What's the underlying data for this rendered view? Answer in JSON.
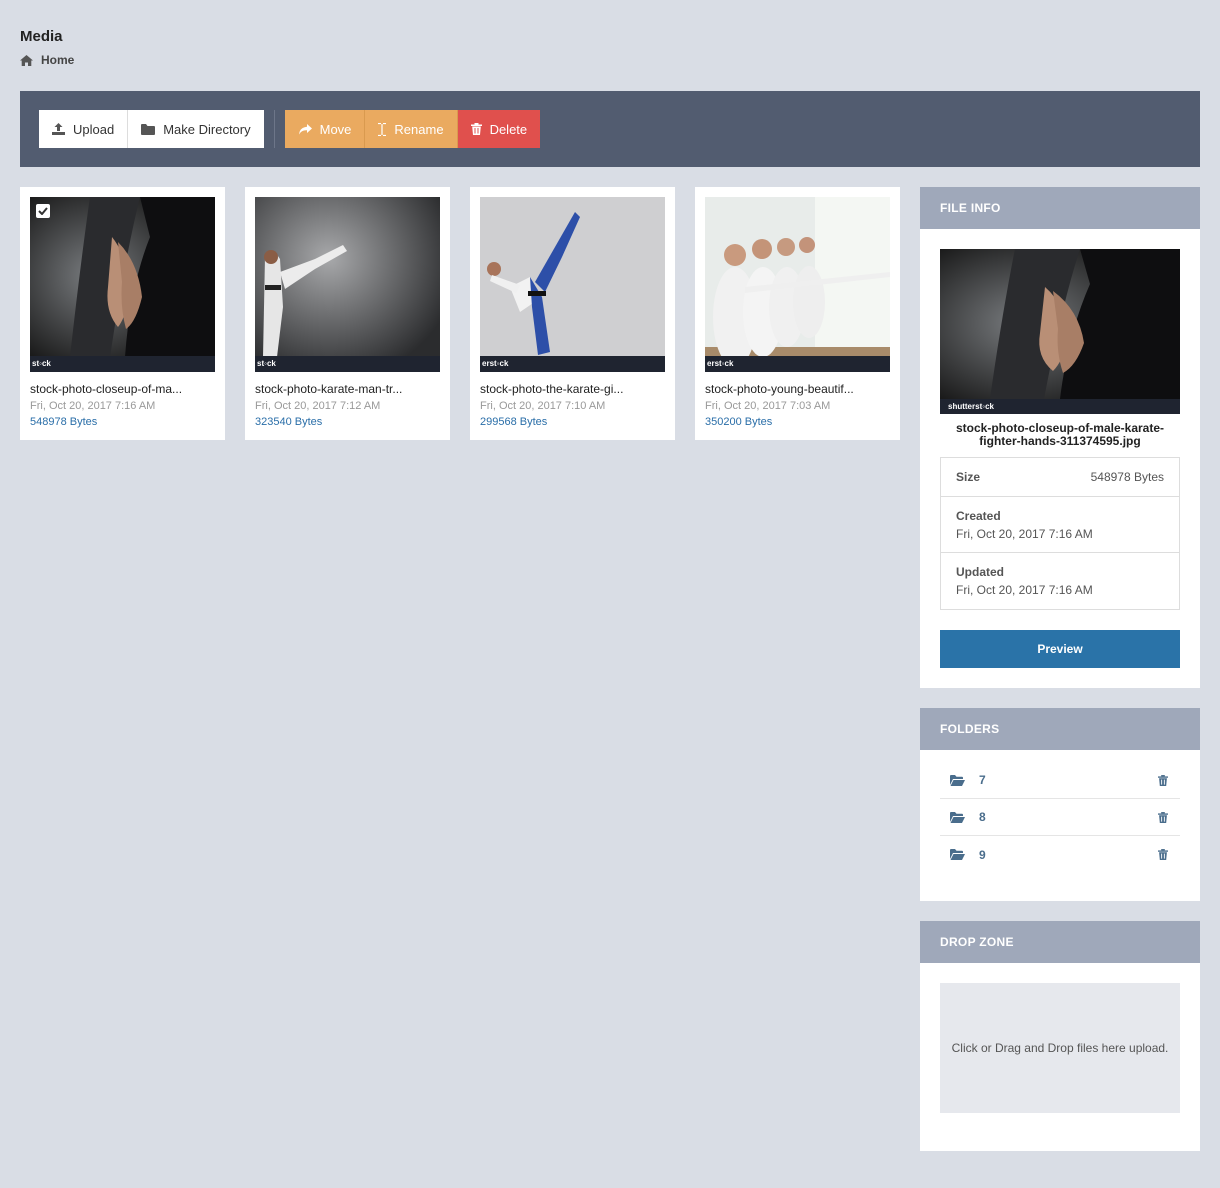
{
  "page": {
    "title": "Media",
    "breadcrumb": "Home"
  },
  "toolbar": {
    "upload": "Upload",
    "make_directory": "Make Directory",
    "move": "Move",
    "rename": "Rename",
    "delete": "Delete"
  },
  "files": [
    {
      "name": "stock-photo-closeup-of-ma...",
      "date": "Fri, Oct 20, 2017 7:16 AM",
      "size": "548978 Bytes",
      "watermark": "st◦ck",
      "selected": true
    },
    {
      "name": "stock-photo-karate-man-tr...",
      "date": "Fri, Oct 20, 2017 7:12 AM",
      "size": "323540 Bytes",
      "watermark": "st◦ck"
    },
    {
      "name": "stock-photo-the-karate-gi...",
      "date": "Fri, Oct 20, 2017 7:10 AM",
      "size": "299568 Bytes",
      "watermark": "erst◦ck"
    },
    {
      "name": "stock-photo-young-beautif...",
      "date": "Fri, Oct 20, 2017 7:03 AM",
      "size": "350200 Bytes",
      "watermark": "erst◦ck"
    }
  ],
  "file_info": {
    "heading": "FILE INFO",
    "image_watermark": "shutterst◦ck",
    "filename": "stock-photo-closeup-of-male-karate-fighter-hands-311374595.jpg",
    "size_label": "Size",
    "size_value": "548978 Bytes",
    "created_label": "Created",
    "created_value": "Fri, Oct 20, 2017 7:16 AM",
    "updated_label": "Updated",
    "updated_value": "Fri, Oct 20, 2017 7:16 AM",
    "preview_label": "Preview"
  },
  "folders": {
    "heading": "FOLDERS",
    "items": [
      {
        "name": "7"
      },
      {
        "name": "8"
      },
      {
        "name": "9"
      }
    ]
  },
  "dropzone": {
    "heading": "DROP ZONE",
    "text": "Click or Drag and Drop files here upload."
  },
  "colors": {
    "background": "#d9dde5",
    "toolbar": "#525c70",
    "orange": "#eaaa60",
    "red": "#e0504d",
    "panel_head": "#9fa8ba",
    "primary": "#2a73a8"
  }
}
